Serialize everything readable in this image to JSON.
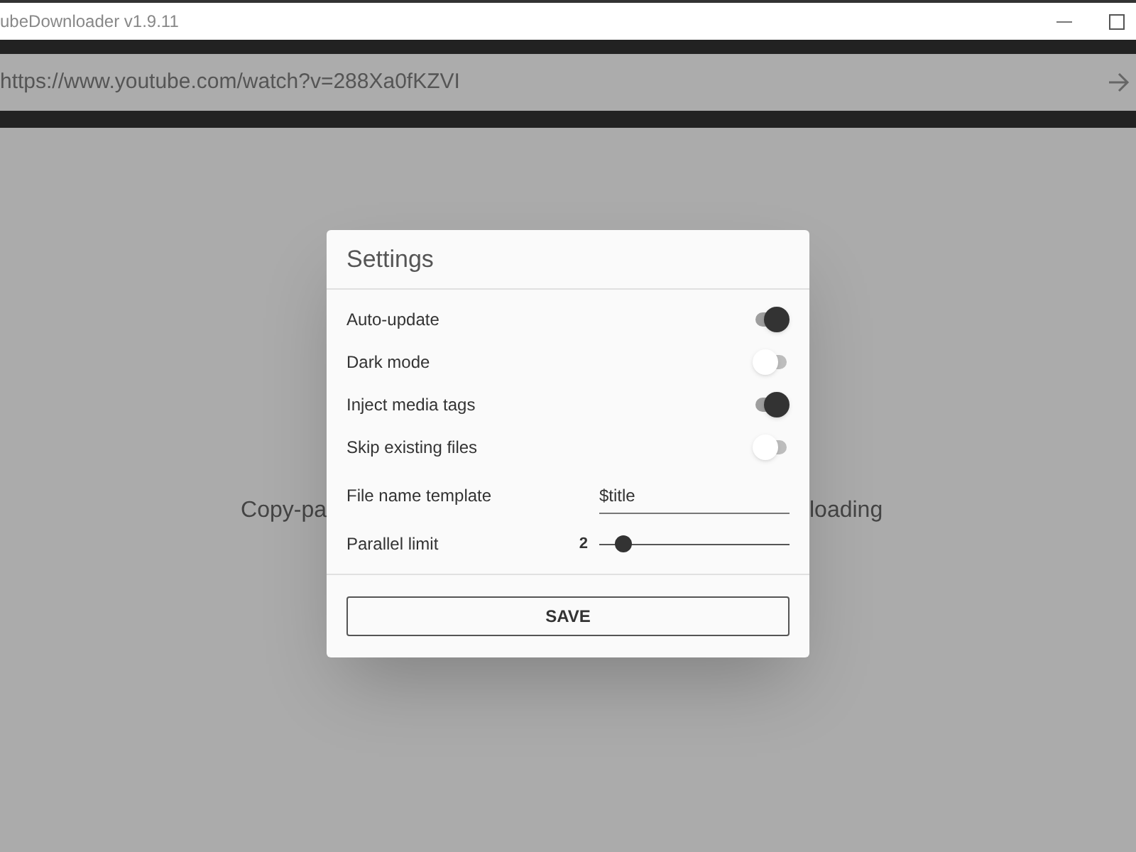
{
  "window": {
    "title": "ubeDownloader v1.9.11"
  },
  "url_bar": {
    "value": "https://www.youtube.com/watch?v=288Xa0fKZVI"
  },
  "background_text": {
    "left": "Copy-pa",
    "right": "loading"
  },
  "settings": {
    "title": "Settings",
    "items": [
      {
        "kind": "toggle",
        "label": "Auto-update",
        "on": true
      },
      {
        "kind": "toggle",
        "label": "Dark mode",
        "on": false
      },
      {
        "kind": "toggle",
        "label": "Inject media tags",
        "on": true
      },
      {
        "kind": "toggle",
        "label": "Skip existing files",
        "on": false
      },
      {
        "kind": "text",
        "label": "File name template",
        "value": "$title"
      },
      {
        "kind": "slider",
        "label": "Parallel limit",
        "reading": "2",
        "level": 0.13
      }
    ],
    "save_button": "SAVE"
  }
}
